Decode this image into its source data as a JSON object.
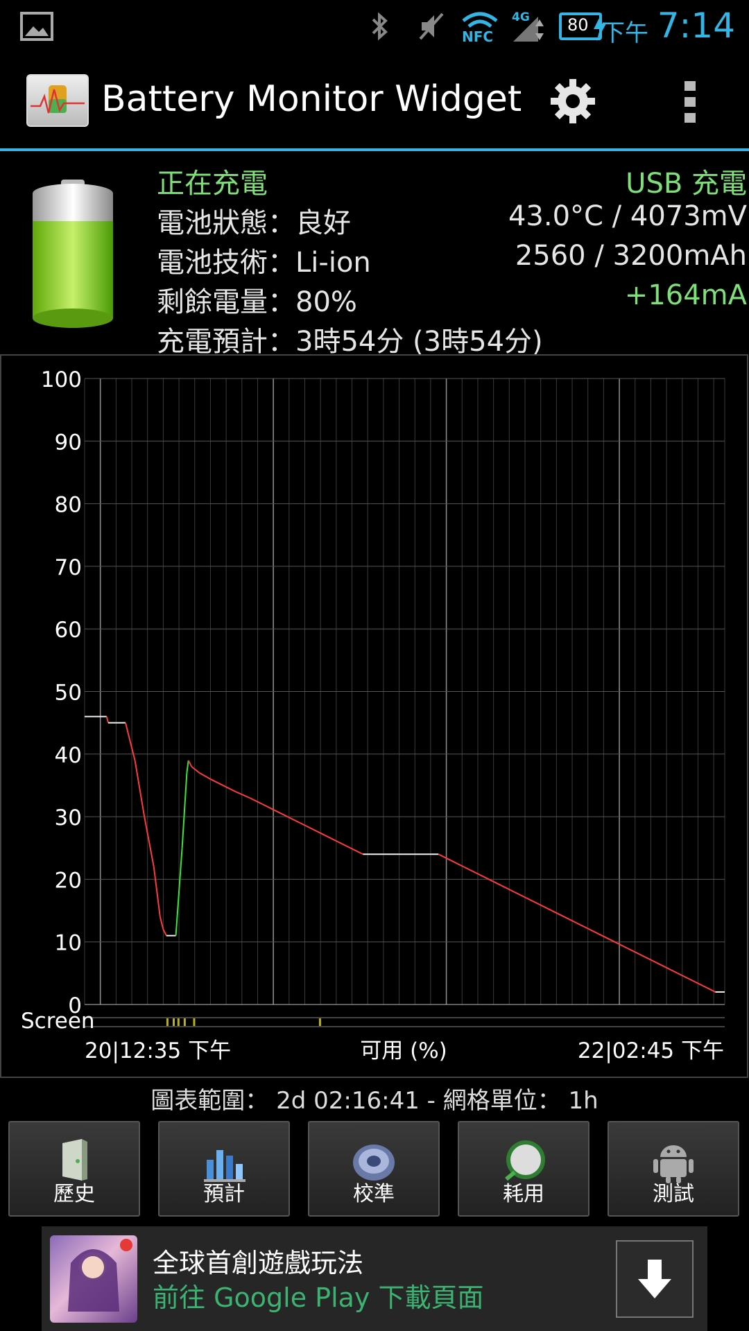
{
  "status_bar": {
    "ampm": "下午",
    "time": "7:14",
    "battery_level": "80",
    "network": "4G",
    "nfc_label": "NFC"
  },
  "app": {
    "title": "Battery Monitor Widget"
  },
  "info": {
    "charging_state": "正在充電",
    "charge_type": "USB 充電",
    "health": "電池狀態：良好",
    "temp_voltage": "43.0°C / 4073mV",
    "technology": "電池技術：Li-ion",
    "capacity": "2560 / 3200mAh",
    "remaining": "剩餘電量：80%",
    "current": "+164mA",
    "estimate": "充電預計：3時54分 (3時54分)"
  },
  "chart_data": {
    "type": "line",
    "ylim": [
      0,
      100
    ],
    "yticks": [
      "0",
      "10",
      "20",
      "30",
      "40",
      "50",
      "60",
      "70",
      "80",
      "90",
      "100"
    ],
    "x_start_label": "20|12:35 下午",
    "x_end_label": "22|02:45 下午",
    "xlabel": "可用 (%)",
    "screen_label": "Screen",
    "series": [
      {
        "name": "",
        "color_discharge": "#ff3b3b",
        "color_charge": "#39e639",
        "points_hours": [
          [
            0,
            46
          ],
          [
            1.4,
            46
          ],
          [
            1.5,
            45
          ],
          [
            2.6,
            45
          ],
          [
            3.2,
            39
          ],
          [
            3.8,
            30
          ],
          [
            4.4,
            22
          ],
          [
            4.8,
            14
          ],
          [
            5.0,
            12
          ],
          [
            5.2,
            11
          ],
          [
            5.8,
            11
          ],
          [
            6.2,
            25
          ],
          [
            6.5,
            37
          ],
          [
            6.6,
            39
          ],
          [
            6.8,
            38
          ],
          [
            7.3,
            37
          ],
          [
            8.0,
            36
          ],
          [
            8.8,
            35
          ],
          [
            9.6,
            34
          ],
          [
            10.5,
            33
          ],
          [
            11.3,
            32
          ],
          [
            12.1,
            31
          ],
          [
            12.9,
            30
          ],
          [
            13.7,
            29
          ],
          [
            14.5,
            28
          ],
          [
            15.3,
            27
          ],
          [
            16.1,
            26
          ],
          [
            16.9,
            25
          ],
          [
            17.7,
            24
          ],
          [
            22.5,
            24
          ],
          [
            23.3,
            23
          ],
          [
            24.1,
            22
          ],
          [
            24.9,
            21
          ],
          [
            25.7,
            20
          ],
          [
            26.5,
            19
          ],
          [
            27.3,
            18
          ],
          [
            28.1,
            17
          ],
          [
            28.9,
            16
          ],
          [
            29.7,
            15
          ],
          [
            30.5,
            14
          ],
          [
            31.3,
            13
          ],
          [
            32.1,
            12
          ],
          [
            32.9,
            11
          ],
          [
            33.7,
            10
          ],
          [
            34.5,
            9
          ],
          [
            35.3,
            8
          ],
          [
            36.1,
            7
          ],
          [
            36.9,
            6
          ],
          [
            37.7,
            5
          ],
          [
            38.5,
            4
          ],
          [
            39.3,
            3
          ],
          [
            40.1,
            2
          ],
          [
            40.7,
            2
          ]
        ],
        "charge_segment_hours": [
          5.8,
          6.6
        ]
      }
    ],
    "total_hours": 40.7,
    "screen_on_marks_hours": [
      5.2,
      5.6,
      5.9,
      6.3,
      6.9,
      14.9
    ]
  },
  "range_text": "圖表範圍： 2d 02:16:41 - 網格單位： 1h",
  "buttons": [
    {
      "label": "歷史"
    },
    {
      "label": "預計"
    },
    {
      "label": "校準"
    },
    {
      "label": "耗用"
    },
    {
      "label": "測試"
    }
  ],
  "ad": {
    "title": "全球首創遊戲玩法",
    "subtitle": "前往 Google Play 下載頁面"
  }
}
